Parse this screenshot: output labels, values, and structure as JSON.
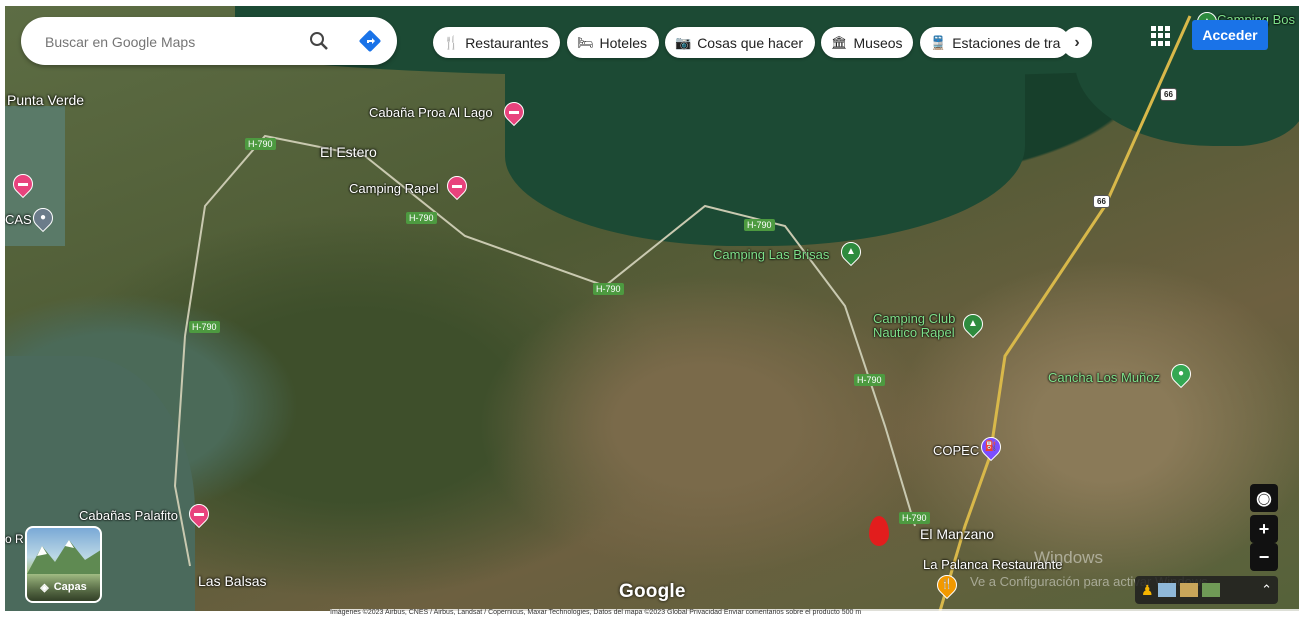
{
  "search": {
    "placeholder": "Buscar en Google Maps"
  },
  "chips": [
    {
      "label": "Restaurantes",
      "icon": "fork-knife-icon"
    },
    {
      "label": "Hoteles",
      "icon": "bed-icon"
    },
    {
      "label": "Cosas que hacer",
      "icon": "camera-icon"
    },
    {
      "label": "Museos",
      "icon": "museum-icon"
    },
    {
      "label": "Estaciones de tra",
      "icon": "train-icon"
    }
  ],
  "header": {
    "signin_label": "Acceder"
  },
  "places": {
    "punta_verde": "Punta Verde",
    "el_estero": "El Estero",
    "las_balsas": "Las Balsas",
    "el_manzano": "El Manzano",
    "cas": "CAS",
    "o_r": "o R"
  },
  "pois": {
    "cabana_proa": "Cabaña Proa Al Lago",
    "camping_rapel": "Camping Rapel",
    "camping_las_brisas": "Camping Las Brisas",
    "camping_club": "Camping Club\nNautico Rapel",
    "cancha": "Cancha Los Muñoz",
    "copec": "COPEC",
    "cabanas_palafito": "Cabañas Palafito",
    "la_palanca": "La Palanca Restaurante",
    "camping_bos": "Camping Bos"
  },
  "roads": {
    "h790": "H-790",
    "r66": "66"
  },
  "layers": {
    "label": "Capas"
  },
  "logo": "Google",
  "watermark": {
    "line1": "Windows",
    "line2": "Ve a Configuración para activar Windows."
  },
  "attribution": "Imágenes ©2023 Airbus, CNES / Airbus, Landsat / Copernicus, Maxar Technologies, Datos del mapa ©2023   Global   Privacidad   Enviar comentarios sobre el producto   500 m",
  "colors": {
    "accent": "#1a73e8",
    "hotel": "#e8437d",
    "camping": "#2e8b3e",
    "green_poi": "#34a853",
    "fuel": "#7c4dff",
    "food": "#f29900"
  }
}
